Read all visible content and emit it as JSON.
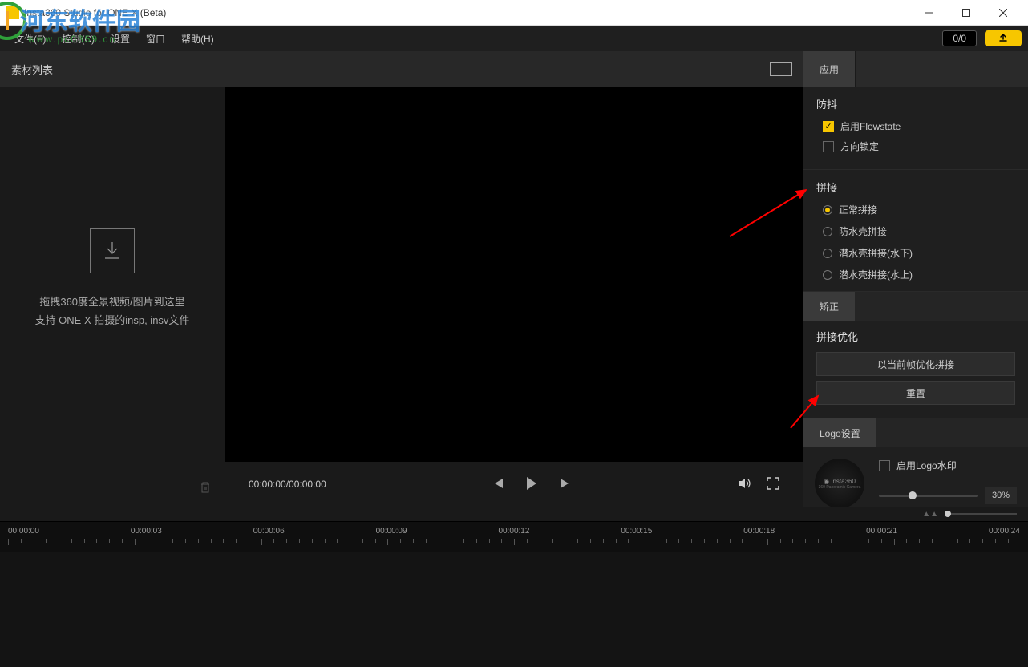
{
  "window": {
    "title": "Insta360 Studio for ONE X (Beta)"
  },
  "watermark": {
    "line1": "河东软件园",
    "line2": "www.pc0359.cn"
  },
  "menubar": {
    "file": "文件(F)",
    "control": "控制(C)",
    "settings": "设置",
    "window": "窗口",
    "help": "帮助(H)",
    "counter": "0/0"
  },
  "sidebar": {
    "title": "素材列表",
    "hint1": "拖拽360度全景视频/图片到这里",
    "hint2": "支持 ONE X 拍摄的insp, insv文件"
  },
  "preview": {
    "time": "00:00:00/00:00:00"
  },
  "right_panel": {
    "tab_apply": "应用",
    "stabilization_title": "防抖",
    "flowstate": "启用Flowstate",
    "direction_lock": "方向锁定",
    "stitch_title": "拼接",
    "stitch_options": [
      "正常拼接",
      "防水壳拼接",
      "潜水壳拼接(水下)",
      "潜水壳拼接(水上)"
    ],
    "calibrate_tab": "矫正",
    "stitch_opt_title": "拼接优化",
    "optimize_current": "以当前帧优化拼接",
    "reset": "重置",
    "logo_tab": "Logo设置",
    "logo_text": "Insta360",
    "logo_sub": "360 Panoramic Camera",
    "enable_logo": "启用Logo水印",
    "logo_opacity": "30%"
  },
  "timeline": {
    "labels": [
      "00:00:00",
      "00:00:03",
      "00:00:06",
      "00:00:09",
      "00:00:12",
      "00:00:15",
      "00:00:18",
      "00:00:21",
      "00:00:24"
    ]
  }
}
